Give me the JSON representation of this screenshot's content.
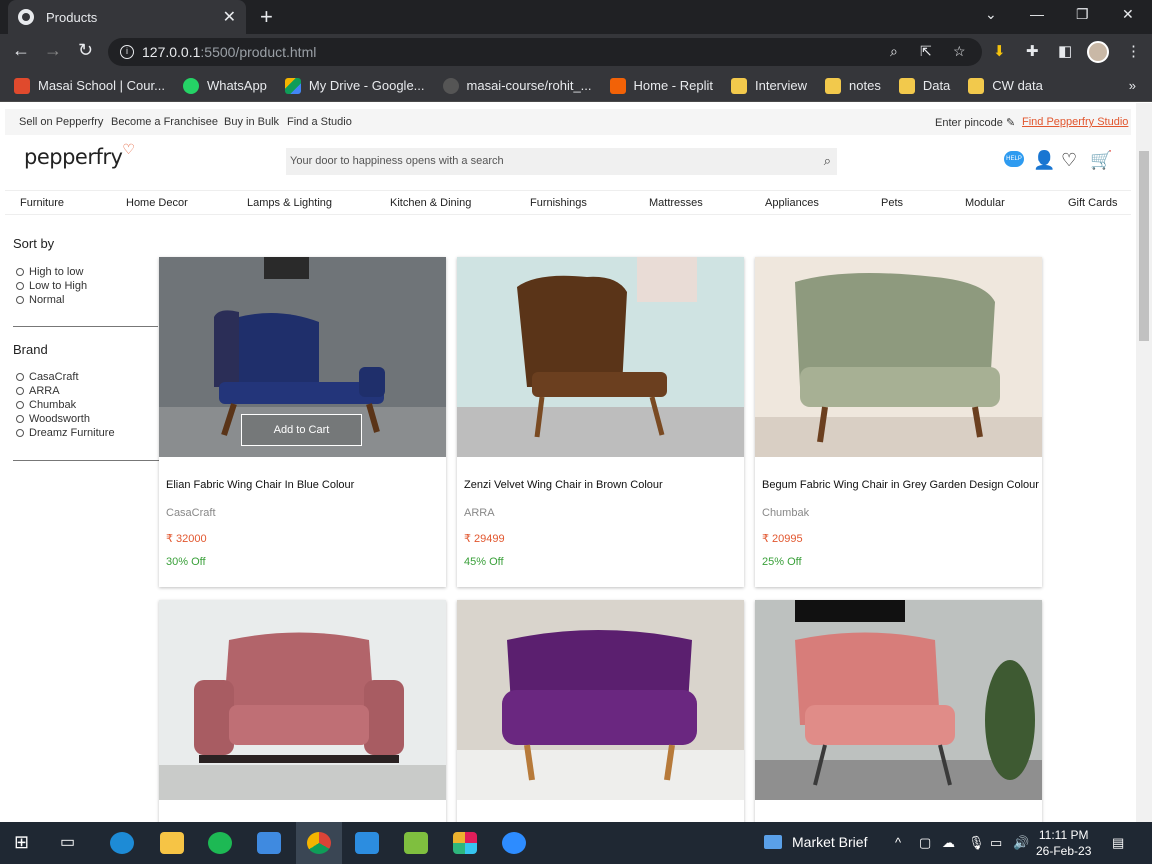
{
  "browser": {
    "tab_title": "Products",
    "url_host": "127.0.0.1",
    "url_path": ":5500/product.html",
    "bookmarks": [
      {
        "label": "Masai School | Cour...",
        "color": "#e04a2d"
      },
      {
        "label": "WhatsApp",
        "color": "#25d366"
      },
      {
        "label": "My Drive - Google...",
        "color": "#f4b400"
      },
      {
        "label": "masai-course/rohit_...",
        "color": "#333333"
      },
      {
        "label": "Home - Replit",
        "color": "#f26207"
      },
      {
        "label": "Interview",
        "color": "#f2c94c"
      },
      {
        "label": "notes",
        "color": "#f2c94c"
      },
      {
        "label": "Data",
        "color": "#f2c94c"
      },
      {
        "label": "CW data",
        "color": "#f2c94c"
      }
    ]
  },
  "site": {
    "topbar_links": [
      "Sell on Pepperfry",
      "Become a Franchisee",
      "Buy in Bulk",
      "Find a Studio"
    ],
    "pincode": "Enter pincode",
    "find_studio": "Find Pepperfry Studio",
    "logo": "pepperfry",
    "search_placeholder": "Your door to happiness opens with a search",
    "help": "HELP",
    "categories": [
      "Furniture",
      "Home Decor",
      "Lamps & Lighting",
      "Kitchen & Dining",
      "Furnishings",
      "Mattresses",
      "Appliances",
      "Pets",
      "Modular",
      "Gift Cards"
    ]
  },
  "sidebar": {
    "sort_heading": "Sort by",
    "sort_options": [
      "High to low",
      "Low to High",
      "Normal"
    ],
    "brand_heading": "Brand",
    "brand_options": [
      "CasaCraft",
      "ARRA",
      "Chumbak",
      "Woodsworth",
      "Dreamz Furniture"
    ]
  },
  "products": [
    {
      "name": "Elian Fabric Wing Chair In Blue Colour",
      "brand": "CasaCraft",
      "price": "₹ 32000",
      "discount": "30% Off",
      "chair_color": "#1f2f6b",
      "bg": "#6f7478",
      "add_to_cart": "Add to Cart"
    },
    {
      "name": "Zenzi Velvet Wing Chair in Brown Colour",
      "brand": "ARRA",
      "price": "₹ 29499",
      "discount": "45% Off",
      "chair_color": "#5a3418",
      "bg": "#cfe3e2"
    },
    {
      "name": "Begum Fabric Wing Chair in Grey Garden Design Colour",
      "brand": "Chumbak",
      "price": "₹ 20995",
      "discount": "25% Off",
      "chair_color": "#8e9a7e",
      "bg": "#efe7dd"
    },
    {
      "chair_color": "#b2646a",
      "bg": "#e9ecec"
    },
    {
      "chair_color": "#5b1f6f",
      "bg": "#d9d4cc"
    },
    {
      "chair_color": "#d77d7a",
      "bg": "#bdc1bf"
    }
  ],
  "taskbar": {
    "market": "Market Brief",
    "time": "11:11 PM",
    "date": "26-Feb-23"
  }
}
